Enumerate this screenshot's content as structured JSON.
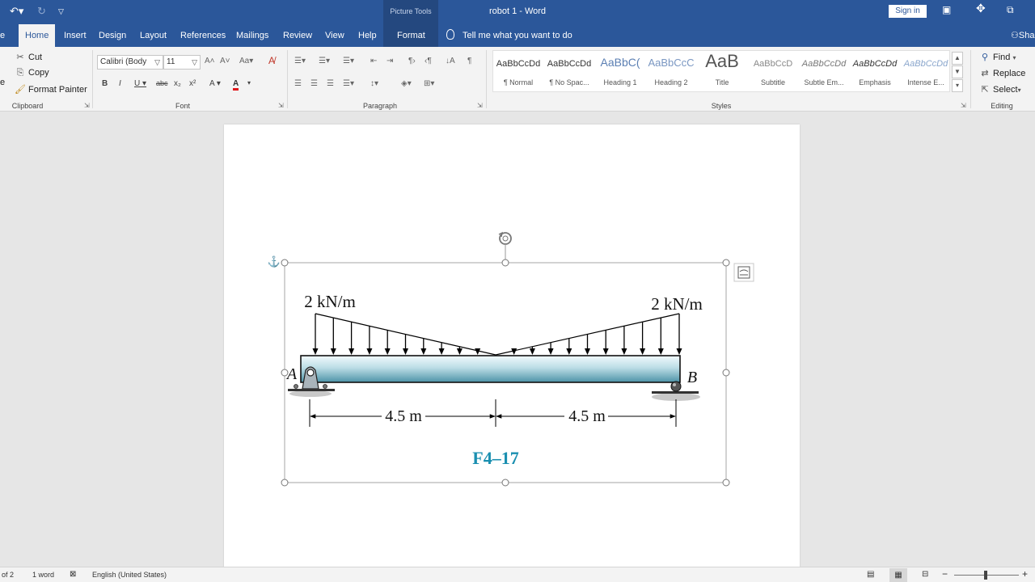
{
  "titlebar": {
    "picture_tools": "Picture Tools",
    "doc_title": "robot 1  -  Word",
    "sign_in": "Sign in"
  },
  "tabs": [
    {
      "label": "e"
    },
    {
      "label": "Home"
    },
    {
      "label": "Insert"
    },
    {
      "label": "Design"
    },
    {
      "label": "Layout"
    },
    {
      "label": "References"
    },
    {
      "label": "Mailings"
    },
    {
      "label": "Review"
    },
    {
      "label": "View"
    },
    {
      "label": "Help"
    },
    {
      "label": "Format"
    }
  ],
  "tell_me": "Tell me what you want to do",
  "share": "Sha",
  "clipboard": {
    "cut": "Cut",
    "copy": "Copy",
    "format_painter": "Format Painter",
    "label": "Clipboard",
    "paste_partial": "e"
  },
  "font": {
    "name": "Calibri (Body",
    "size": "11",
    "label": "Font"
  },
  "paragraph": {
    "label": "Paragraph"
  },
  "styles": {
    "label": "Styles",
    "items": [
      {
        "sample": "AaBbCcDd",
        "name": "¶ Normal"
      },
      {
        "sample": "AaBbCcDd",
        "name": "¶ No Spac..."
      },
      {
        "sample": "AaBbC(",
        "name": "Heading 1"
      },
      {
        "sample": "AaBbCcC",
        "name": "Heading 2"
      },
      {
        "sample": "AaB",
        "name": "Title"
      },
      {
        "sample": "AaBbCcD",
        "name": "Subtitle"
      },
      {
        "sample": "AaBbCcDd",
        "name": "Subtle Em..."
      },
      {
        "sample": "AaBbCcDd",
        "name": "Emphasis"
      },
      {
        "sample": "AaBbCcDd",
        "name": "Intense E..."
      }
    ]
  },
  "editing": {
    "find": "Find",
    "replace": "Replace",
    "select": "Select",
    "label": "Editing"
  },
  "figure": {
    "load_left": "2 kN/m",
    "load_right": "2 kN/m",
    "support_a": "A",
    "support_b": "B",
    "span_left": "4.5 m",
    "span_right": "4.5 m",
    "caption": "F4–17"
  },
  "statusbar": {
    "page": "of 2",
    "words": "1 word",
    "language": "English (United States)"
  },
  "colors": {
    "word_blue": "#2b579a",
    "caption_teal": "#1a8fb0",
    "font_color_red": "#e0161a"
  }
}
